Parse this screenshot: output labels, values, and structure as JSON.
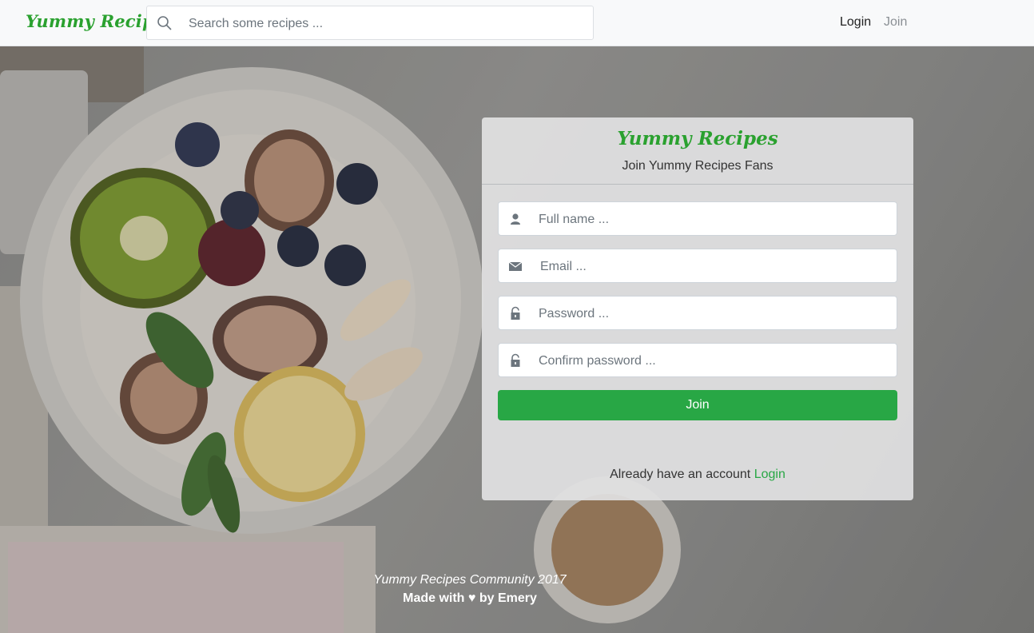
{
  "navbar": {
    "brand": "Yummy Recipes",
    "search_placeholder": "Search some recipes ...",
    "search_icon": "search-icon",
    "links": {
      "login": "Login",
      "join": "Join"
    }
  },
  "card": {
    "title": "Yummy Recipes",
    "subtitle": "Join Yummy Recipes Fans",
    "fields": {
      "fullname": {
        "placeholder": "Full name ...",
        "icon": "user-icon"
      },
      "email": {
        "placeholder": "Email ...",
        "icon": "envelope-icon"
      },
      "password": {
        "placeholder": "Password ...",
        "icon": "lock-icon"
      },
      "confirm": {
        "placeholder": "Confirm password ...",
        "icon": "lock-icon"
      }
    },
    "join_button": "Join",
    "already_text": "Already have an account",
    "login_link": "Login"
  },
  "footer": {
    "line1": "Yummy Recipes Community 2017",
    "line2": "Made with ♥ by Emery"
  },
  "colors": {
    "brand_green": "#2aa12f",
    "button_green": "#28a745",
    "navbar_bg": "#f8f9fa"
  }
}
